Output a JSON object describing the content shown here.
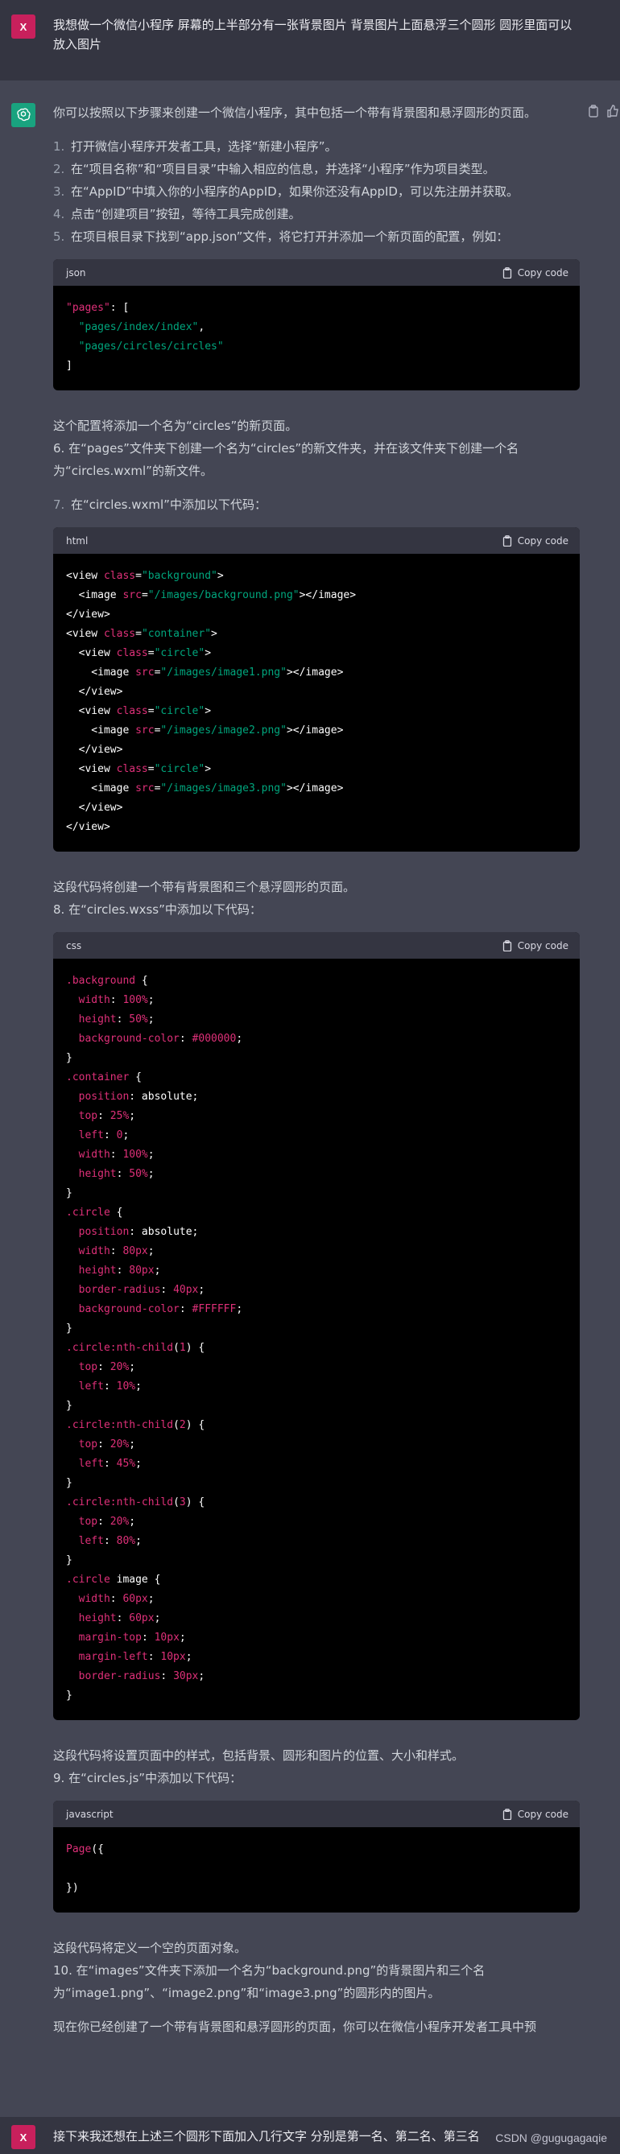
{
  "user_message_1": {
    "avatar": "X",
    "text": "我想做一个微信小程序 屏幕的上半部分有一张背景图片 背景图片上面悬浮三个圆形 圆形里面可以放入图片"
  },
  "assistant": {
    "intro": "你可以按照以下步骤来创建一个微信小程序，其中包括一个带有背景图和悬浮圆形的页面。",
    "steps": [
      {
        "num": "1.",
        "text": "打开微信小程序开发者工具，选择“新建小程序”。"
      },
      {
        "num": "2.",
        "text": "在“项目名称”和“项目目录”中输入相应的信息，并选择“小程序”作为项目类型。"
      },
      {
        "num": "3.",
        "text": "在“AppID”中填入你的小程序的AppID，如果你还没有AppID，可以先注册并获取。"
      },
      {
        "num": "4.",
        "text": "点击“创建项目”按钮，等待工具完成创建。"
      },
      {
        "num": "5.",
        "text": "在项目根目录下找到“app.json”文件，将它打开并添加一个新页面的配置，例如："
      }
    ],
    "code1_lang": "json",
    "after_code1": "这个配置将添加一个名为“circles”的新页面。",
    "step6": "6. 在“pages”文件夹下创建一个名为“circles”的新文件夹，并在该文件夹下创建一个名为“circles.wxml”的新文件。",
    "step7_num": "7.",
    "step7_text": "在“circles.wxml”中添加以下代码：",
    "code2_lang": "html",
    "after_code2": "这段代码将创建一个带有背景图和三个悬浮圆形的页面。",
    "step8": "8. 在“circles.wxss”中添加以下代码：",
    "code3_lang": "css",
    "after_code3": "这段代码将设置页面中的样式，包括背景、圆形和图片的位置、大小和样式。",
    "step9": "9. 在“circles.js”中添加以下代码：",
    "code4_lang": "javascript",
    "after_code4": "这段代码将定义一个空的页面对象。",
    "step10": "10. 在“images”文件夹下添加一个名为“background.png”的背景图片和三个名为“image1.png”、“image2.png”和“image3.png”的圆形内的图片。",
    "closing": "现在你已经创建了一个带有背景图和悬浮圆形的页面，你可以在微信小程序开发者工具中预"
  },
  "copy_label": "Copy code",
  "user_message_2": {
    "avatar": "X",
    "text": "接下来我还想在上述三个圆形下面加入几行文字 分别是第一名、第二名、第三名"
  },
  "watermark": "CSDN @gugugagaqie",
  "colors": {
    "user_bg": "#343541",
    "assistant_bg": "#444654",
    "user_avatar": "#c8205c",
    "ai_avatar": "#19a37f",
    "code_red": "#df3079",
    "code_green": "#00a67d"
  },
  "icons": [
    "openai-logo-icon",
    "copy-icon",
    "thumbs-up-icon",
    "clipboard-icon"
  ]
}
